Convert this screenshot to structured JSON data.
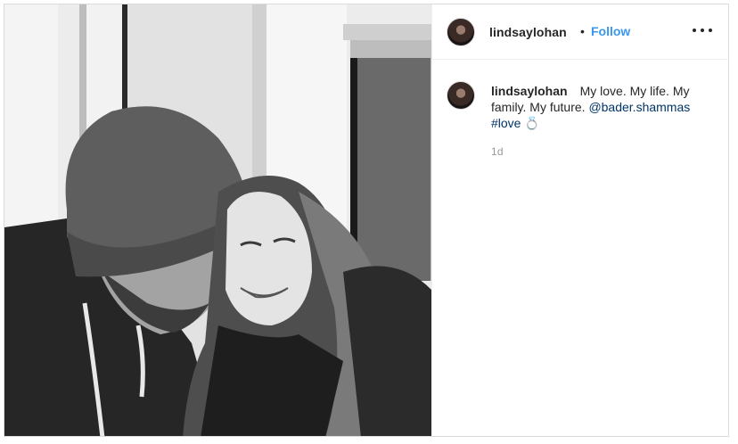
{
  "post": {
    "username": "lindsaylohan",
    "header_dot": "•",
    "follow_label": "Follow",
    "more_icon": "more-horizontal-icon",
    "caption": {
      "username": "lindsaylohan",
      "text": "My love. My life. My family. My future.",
      "mention": "@bader.shammas",
      "hashtag": "#love",
      "emoji": "💍"
    },
    "time": "1d"
  },
  "colors": {
    "link_blue": "#3897f0",
    "mention_blue": "#003569",
    "text": "#262626",
    "muted": "#999999",
    "border": "#dbdbdb"
  }
}
